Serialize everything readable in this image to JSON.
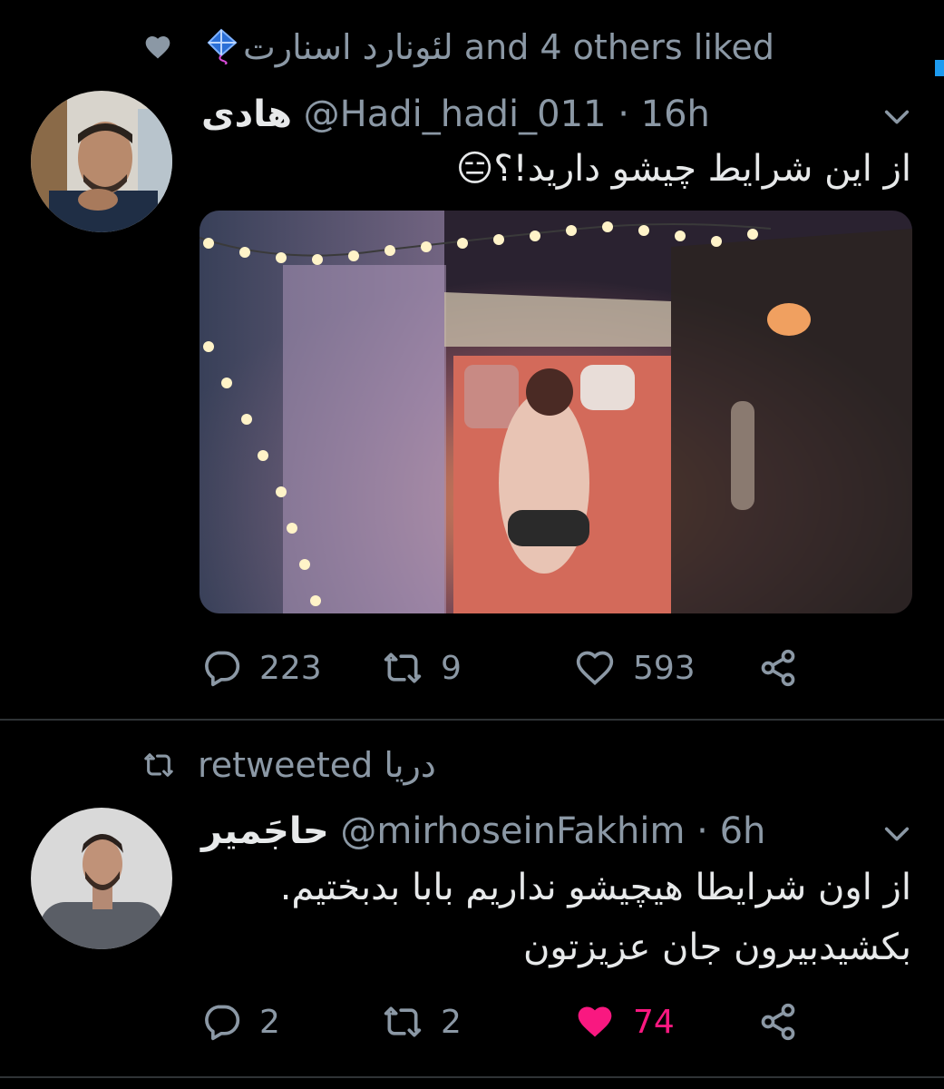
{
  "context": {
    "liker_name": "لئونارد اسنارت",
    "liked_suffix": "and 4 others liked"
  },
  "tweet1": {
    "display_name": "هادی",
    "handle": "@Hadi_hadi_011",
    "dot": "·",
    "time": "16h",
    "text": "از این شرایط چیشو دارید!؟😑",
    "stats": {
      "replies": "223",
      "retweets": "9",
      "likes": "593"
    }
  },
  "retweet_context": {
    "retweeter": "دریا",
    "label": "retweeted"
  },
  "tweet2": {
    "display_name": "حاجَمیر",
    "handle": "@mirhoseinFakhim",
    "dot": "·",
    "time": "6h",
    "text_line1": "از اون شرایطا هیچیشو نداریم بابا بدبختیم.",
    "text_line2": "بکشیدبیرون جان عزیزتون",
    "stats": {
      "replies": "2",
      "retweets": "2",
      "likes": "74"
    },
    "liked_color": "#f91880"
  },
  "icons": [
    "heart-icon",
    "kite-icon",
    "chevron-down-icon",
    "reply-icon",
    "retweet-icon",
    "share-icon"
  ]
}
